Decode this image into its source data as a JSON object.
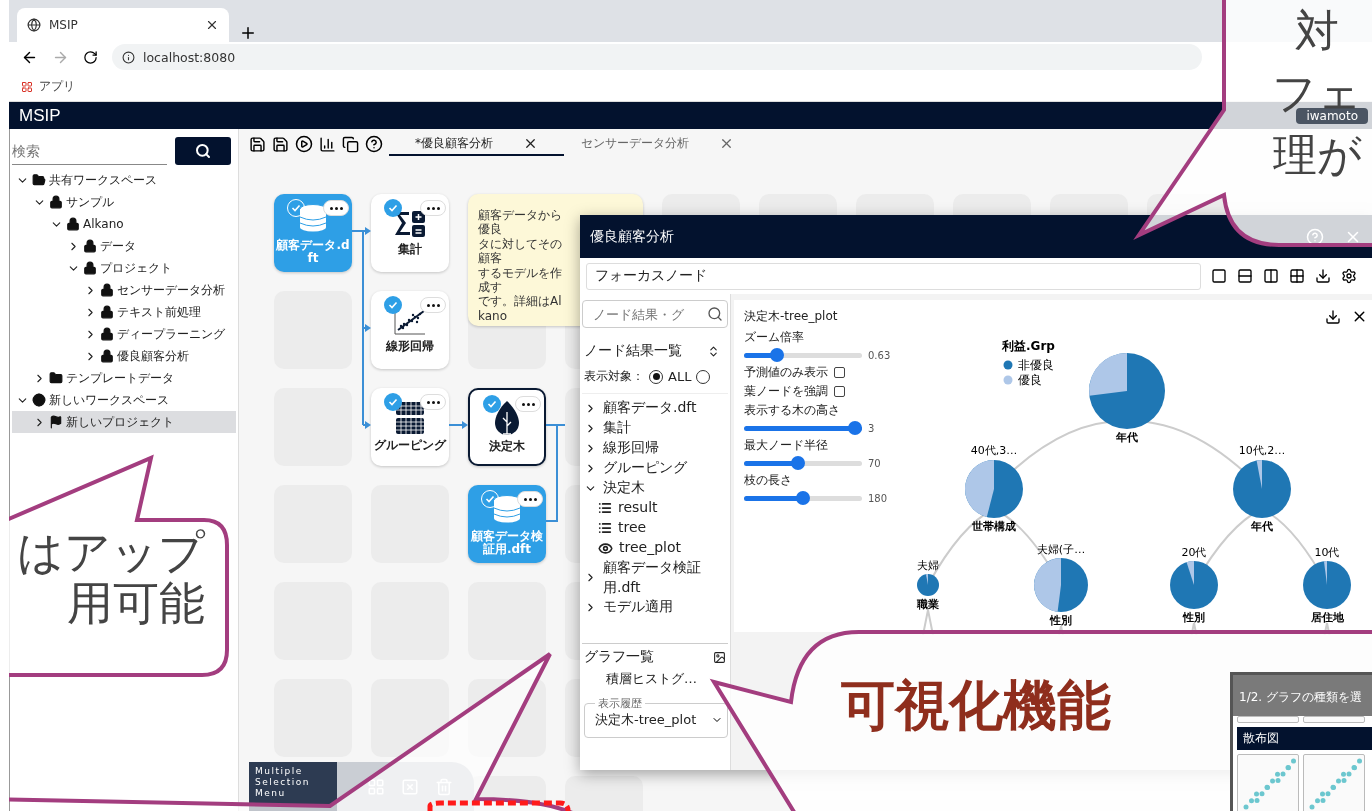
{
  "browser": {
    "tab_title": "MSIP",
    "url": "localhost:8080",
    "bookmarks": [
      {
        "label": "アプリ"
      }
    ]
  },
  "app": {
    "title": "MSIP",
    "user": "iwamoto"
  },
  "sidebar": {
    "search_placeholder": "検索",
    "tree": [
      {
        "label": "共有ワークスペース",
        "kind": "shared",
        "expanded": true,
        "selected": false,
        "children": [
          {
            "label": "サンプル",
            "kind": "lock",
            "expanded": true,
            "selected": false,
            "children": [
              {
                "label": "Alkano",
                "kind": "lock",
                "expanded": true,
                "selected": false,
                "children": [
                  {
                    "label": "データ",
                    "kind": "lock",
                    "expanded": false,
                    "selected": false
                  },
                  {
                    "label": "プロジェクト",
                    "kind": "lock",
                    "expanded": true,
                    "selected": false,
                    "children": [
                      {
                        "label": "センサーデータ分析",
                        "kind": "lock",
                        "expanded": false,
                        "selected": false
                      },
                      {
                        "label": "テキスト前処理",
                        "kind": "lock",
                        "expanded": false,
                        "selected": false
                      },
                      {
                        "label": "ディープラーニング",
                        "kind": "lock",
                        "expanded": false,
                        "selected": false
                      },
                      {
                        "label": "優良顧客分析",
                        "kind": "lock",
                        "expanded": false,
                        "selected": false
                      }
                    ]
                  }
                ]
              }
            ]
          },
          {
            "label": "テンプレートデータ",
            "kind": "folder",
            "expanded": false,
            "selected": false
          }
        ]
      },
      {
        "label": "新しいワークスペース",
        "kind": "globe",
        "expanded": true,
        "selected": false,
        "children": [
          {
            "label": "新しいプロジェクト",
            "kind": "flag",
            "expanded": false,
            "selected": true
          }
        ]
      }
    ]
  },
  "editor": {
    "tabs": [
      {
        "label": "*優良顧客分析",
        "selected": true
      },
      {
        "label": "センサーデータ分析",
        "selected": false
      }
    ]
  },
  "canvas": {
    "rows": [
      [
        {
          "kind": "data",
          "label": "顧客データ.dft",
          "done": true,
          "selected": false
        },
        {
          "kind": "aggregate",
          "label": "集計",
          "done": true,
          "selected": false
        },
        {
          "kind": "note",
          "lines": [
            "顧客データから優良",
            "タに対してその顧客",
            "するモデルを作成す",
            "です。詳細はAlkano"
          ]
        }
      ],
      [
        {
          "kind": "empty"
        },
        {
          "kind": "regression",
          "label": "線形回帰",
          "done": true,
          "selected": false
        }
      ],
      [
        {
          "kind": "empty"
        },
        {
          "kind": "grouping",
          "label": "グルーピング",
          "done": true,
          "selected": false
        },
        {
          "kind": "decision-tree",
          "label": "決定木",
          "done": true,
          "selected": true
        }
      ],
      [
        {
          "kind": "empty"
        },
        {
          "kind": "empty"
        },
        {
          "kind": "data",
          "label": "顧客データ検証用.dft",
          "done": true,
          "selected": false
        }
      ]
    ]
  },
  "multi_select": {
    "label": "Multiple Selection Menu"
  },
  "dialog": {
    "title": "優良顧客分析",
    "focus_field": {
      "value": "フォーカスノード"
    },
    "results": {
      "search_placeholder": "ノード結果・グ",
      "heading": "ノード結果一覧",
      "filter_label": "表示対象：",
      "filter_options": [
        {
          "label": "ALL",
          "selected": true
        },
        {
          "selected": false
        }
      ],
      "items": [
        {
          "label": "顧客データ.dft",
          "kind": "node",
          "expanded": false
        },
        {
          "label": "集計",
          "kind": "node",
          "expanded": false
        },
        {
          "label": "線形回帰",
          "kind": "node",
          "expanded": false
        },
        {
          "label": "グルーピング",
          "kind": "node",
          "expanded": false
        },
        {
          "label": "決定木",
          "kind": "node",
          "expanded": true,
          "children": [
            {
              "label": "result",
              "kind": "table"
            },
            {
              "label": "tree",
              "kind": "table"
            },
            {
              "label": "tree_plot",
              "kind": "plot"
            }
          ]
        },
        {
          "label": "顧客データ検証用.dft",
          "kind": "node",
          "expanded": false
        },
        {
          "label": "モデル適用",
          "kind": "node",
          "expanded": false
        }
      ]
    },
    "graphs": {
      "heading": "グラフ一覧",
      "items": [
        "積層ヒストグ…"
      ]
    },
    "history": {
      "label": "表示履歴",
      "value": "決定木-tree_plot"
    },
    "plot": {
      "title": "決定木-tree_plot",
      "controls": [
        {
          "kind": "slider",
          "label": "ズーム倍率",
          "level": 0.25,
          "reading": "0.63"
        },
        {
          "kind": "checkbox",
          "label": "予測値のみ表示",
          "checked": false
        },
        {
          "kind": "checkbox",
          "label": "葉ノードを強調",
          "checked": false
        },
        {
          "kind": "slider",
          "label": "表示する木の高さ",
          "level": 1,
          "reading": "3"
        },
        {
          "kind": "slider",
          "label": "最大ノード半径",
          "level": 0.45,
          "reading": "70"
        },
        {
          "kind": "slider",
          "label": "枝の長さ",
          "level": 0.5,
          "reading": "180"
        }
      ],
      "legend": {
        "title": "利益.Grp",
        "items": [
          {
            "label": "非優良",
            "color": "#1f77b4"
          },
          {
            "label": "優良",
            "color": "#aec7e8"
          }
        ]
      },
      "tree": {
        "name": "年代",
        "children": [
          {
            "edge": "40代,3…",
            "name": "世帯構成",
            "children": [
              {
                "edge": "夫婦",
                "name": "職業"
              },
              {
                "edge": "夫婦(子…",
                "name": "性別"
              }
            ]
          },
          {
            "edge": "10代,2…",
            "name": "年代",
            "children": [
              {
                "edge": "20代",
                "name": "性別"
              },
              {
                "edge": "10代",
                "name": "居住地"
              }
            ]
          }
        ]
      }
    }
  },
  "graph_picker": {
    "title": "1/2. グラフの種類を選",
    "section": "散布図"
  },
  "callouts": [
    {
      "kind": "top",
      "lines": [
        "対",
        "フェ",
        "理が"
      ]
    },
    {
      "kind": "left",
      "lines": [
        "はアップ",
        "用可能"
      ]
    },
    {
      "kind": "bottom",
      "lines": [
        "可視化機能"
      ]
    }
  ]
}
